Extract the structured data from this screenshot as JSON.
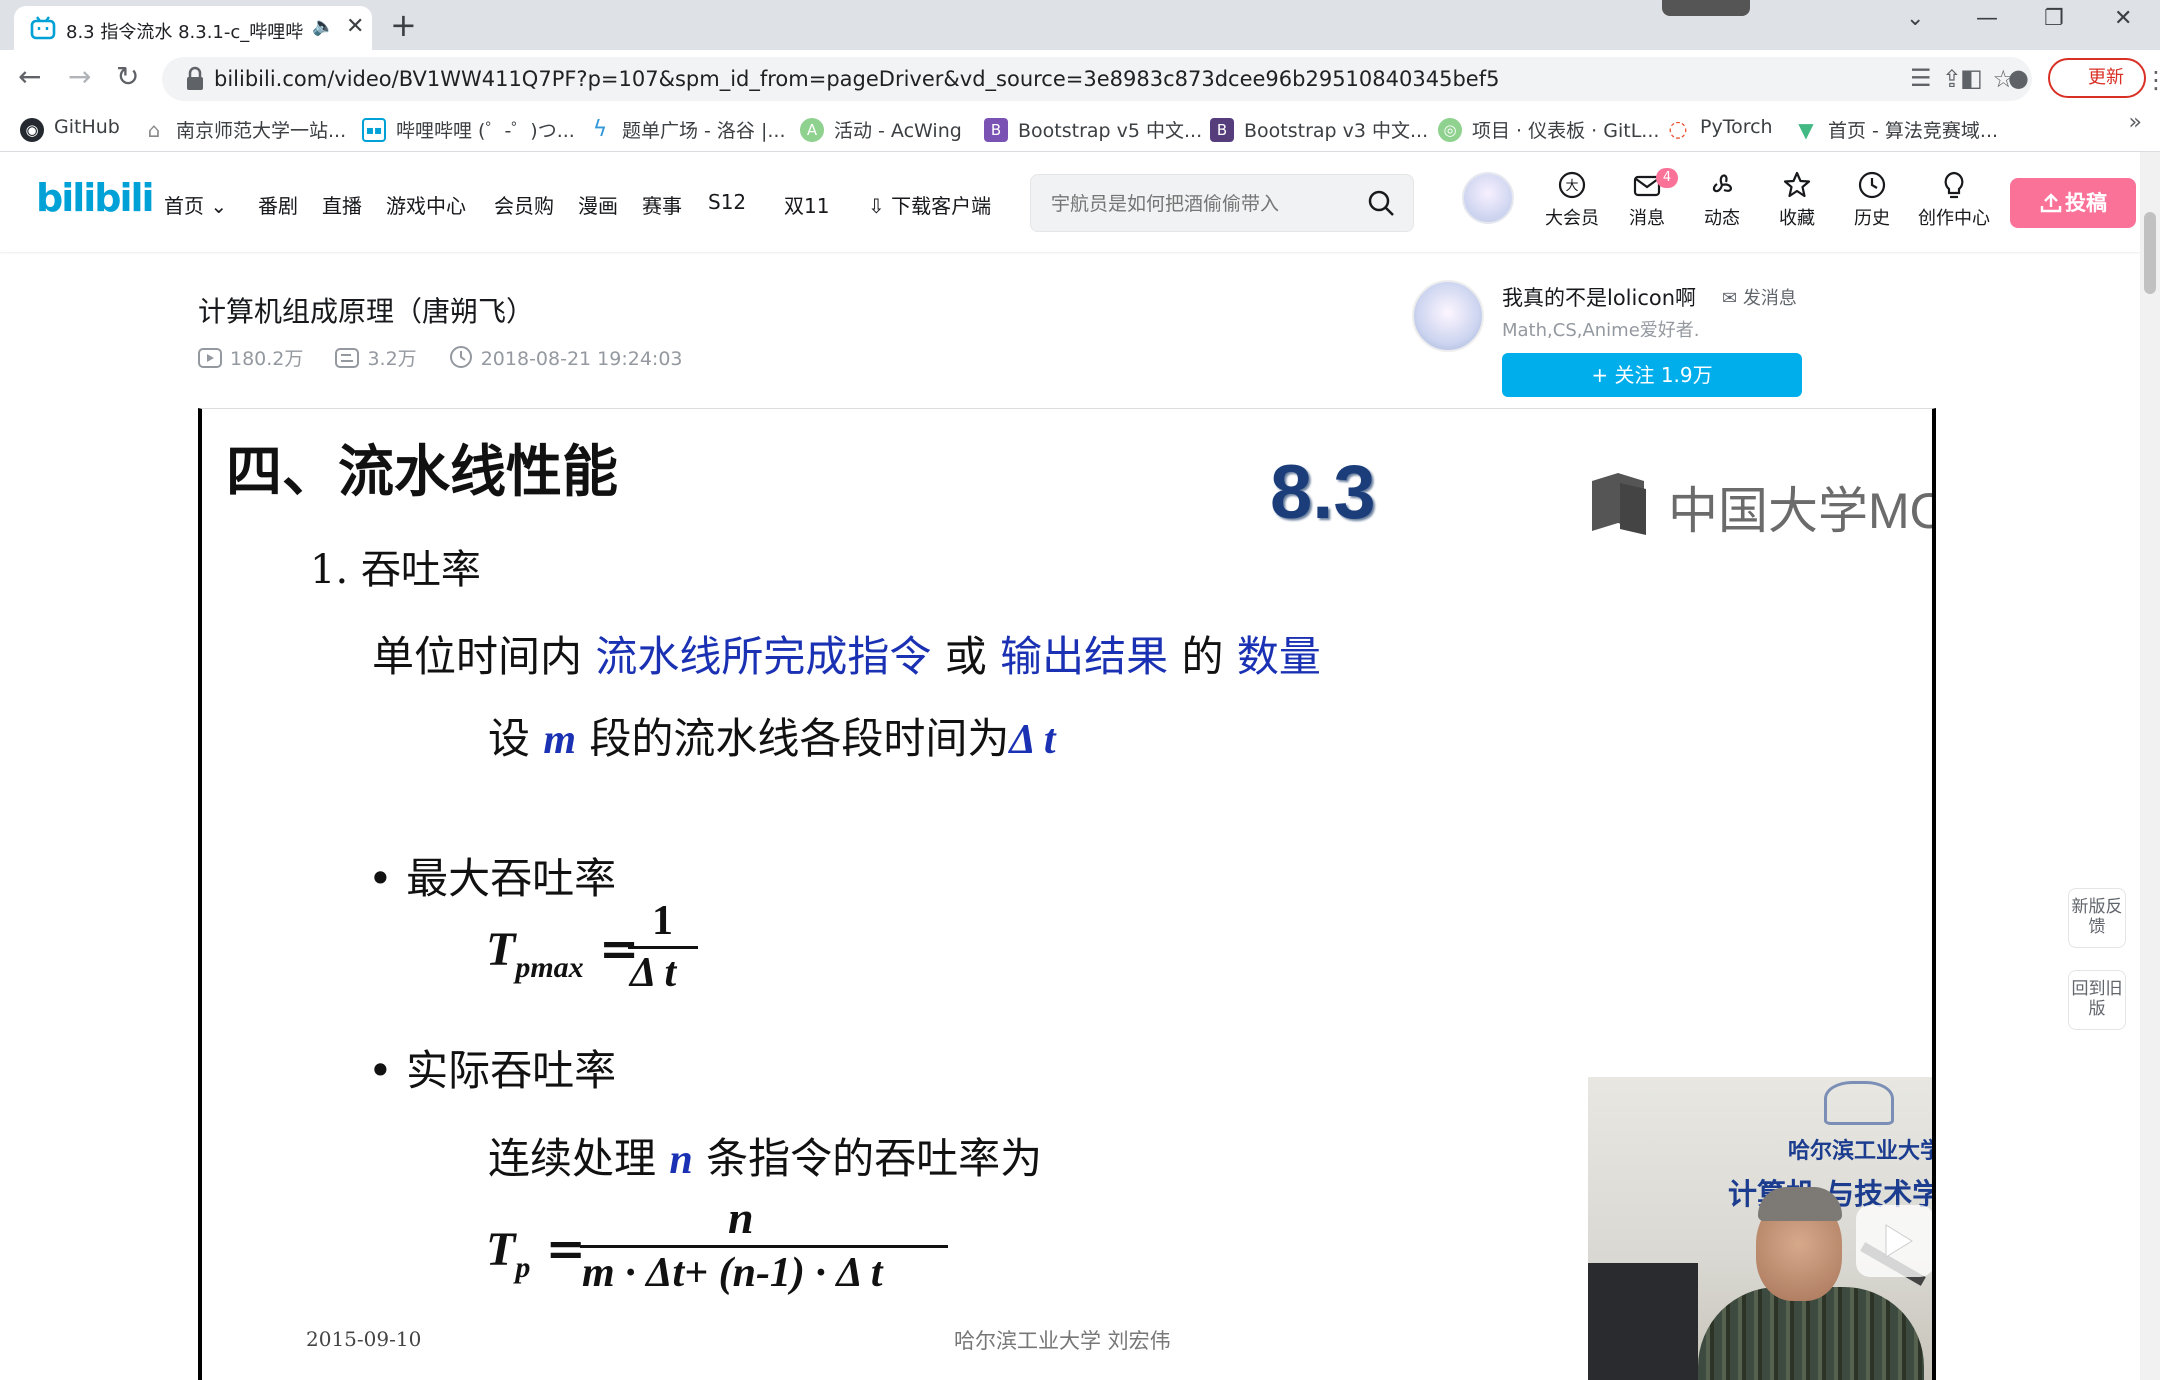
{
  "browser": {
    "tab_title": "8.3 指令流水 8.3.1-c_哔哩哔",
    "url": "bilibili.com/video/BV1WW411Q7PF?p=107&spm_id_from=pageDriver&vd_source=3e8983c873dcee96b29510840345bef5",
    "update_label": "更新",
    "bookmarks": [
      {
        "label": "GitHub",
        "icon": "github-icon"
      },
      {
        "label": "南京师范大学一站...",
        "icon": "home-icon"
      },
      {
        "label": "哔哩哔哩 (゜-゜)つ...",
        "icon": "bilibili-icon"
      },
      {
        "label": "题单广场 - 洛谷 |...",
        "icon": "luogu-icon"
      },
      {
        "label": "活动 - AcWing",
        "icon": "acwing-icon"
      },
      {
        "label": "Bootstrap v5 中文...",
        "icon": "bootstrap-icon"
      },
      {
        "label": "Bootstrap v3 中文...",
        "icon": "bootstrap-icon"
      },
      {
        "label": "项目 · 仪表板 · GitL...",
        "icon": "gitlab-icon"
      },
      {
        "label": "PyTorch",
        "icon": "pytorch-icon"
      },
      {
        "label": "首页 - 算法竞赛域...",
        "icon": "vue-icon"
      }
    ],
    "more_bookmarks": "»"
  },
  "header": {
    "logo": "bilibili",
    "nav": [
      "首页",
      "番剧",
      "直播",
      "游戏中心",
      "会员购",
      "漫画",
      "赛事",
      "S12",
      "双11"
    ],
    "download": "下载客户端",
    "search_placeholder": "宇航员是如何把酒偷偷带入",
    "icons": [
      {
        "label": "大会员",
        "icon": "vip-icon"
      },
      {
        "label": "消息",
        "icon": "message-icon"
      },
      {
        "label": "动态",
        "icon": "dynamic-icon"
      },
      {
        "label": "收藏",
        "icon": "star-icon"
      },
      {
        "label": "历史",
        "icon": "history-icon"
      },
      {
        "label": "创作中心",
        "icon": "bulb-icon"
      }
    ],
    "message_count": "4",
    "upload": "投稿",
    "accent": "#fb7299"
  },
  "video": {
    "title": "计算机组成原理（唐朔飞）",
    "views": "180.2万",
    "danmaku": "3.2万",
    "date": "2018-08-21 19:24:03"
  },
  "uploader": {
    "name": "我真的不是lolicon啊",
    "send_message": "发消息",
    "description": "Math,CS,Anime爱好者.",
    "follow": "+ 关注 1.9万",
    "follow_color": "#00aeec"
  },
  "slide": {
    "heading": "四、流水线性能",
    "section_badge": "8.3",
    "mooc_logo": "中国大学MOOC",
    "item1": "1.  吞吐率",
    "def_a": "单位时间内",
    "def_b": "流水线所完成指令",
    "def_c": "或",
    "def_d": "输出结果",
    "def_e": "的",
    "def_f": "数量",
    "setup_a": "设",
    "setup_m": "m",
    "setup_b": "段的流水线各段时间为",
    "setup_dt": "Δ t",
    "bullet1": "• 最大吞吐率",
    "tpmax_T": "T",
    "tpmax_sub": "pmax",
    "eq": "=",
    "one": "1",
    "dt": "Δ t",
    "bullet2": "• 实际吞吐率",
    "cont_a": "连续处理",
    "cont_n": "n",
    "cont_b": "条指令的吞吐率为",
    "tp_T": "T",
    "tp_sub": "p",
    "tp_num": "n",
    "tp_den": "m · Δt+ (n-1) · Δ t",
    "footer_date": "2015-09-10",
    "footer_author": "哈尔滨工业大学  刘宏伟",
    "pip_banner1": "哈尔滨工业大学",
    "pip_banner2": "计算机    与技术学院"
  },
  "side": {
    "feedback": "新版反馈",
    "old_version": "回到旧版"
  }
}
